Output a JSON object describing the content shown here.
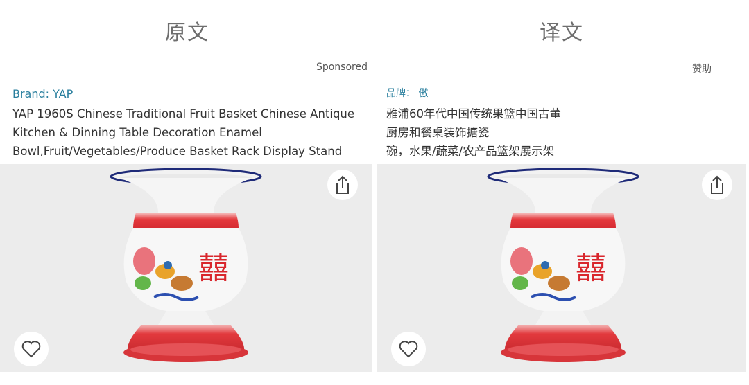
{
  "left": {
    "heading": "原文",
    "sponsored": "Sponsored",
    "brand": "Brand: YAP",
    "title_lines": [
      "YAP 1960S Chinese Traditional Fruit Basket Chinese Antique",
      "Kitchen & Dinning Table Decoration Enamel",
      "Bowl,Fruit/Vegetables/Produce Basket Rack Display Stand"
    ]
  },
  "right": {
    "heading": "译文",
    "sponsored": "赞助",
    "brand": "品牌： 傲",
    "title_lines": [
      "雅浦60年代中国传统果篮中国古董",
      "厨房和餐桌装饰搪瓷",
      "碗，水果/蔬菜/农产品篮架展示架"
    ]
  },
  "icons": {
    "share": "share-icon",
    "favorite": "heart-icon",
    "product_image": "enamel-vase-image"
  },
  "colors": {
    "brand": "#2a7f9e",
    "vase_red": "#e0353b",
    "image_bg": "#ececec"
  },
  "vase_characters": "囍"
}
